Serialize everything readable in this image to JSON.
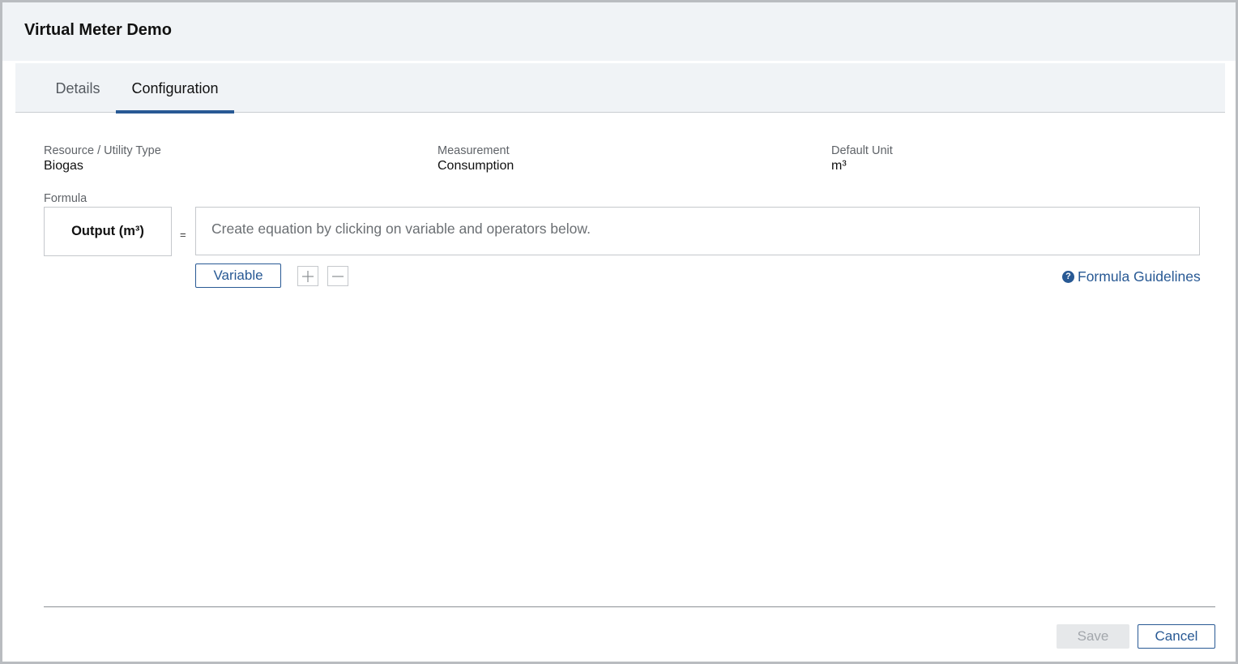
{
  "dialog": {
    "title": "Virtual Meter Demo"
  },
  "tabs": [
    {
      "label": "Details",
      "active": false
    },
    {
      "label": "Configuration",
      "active": true
    }
  ],
  "fields": {
    "resource_label": "Resource / Utility Type",
    "resource_value": "Biogas",
    "measurement_label": "Measurement",
    "measurement_value": "Consumption",
    "unit_label": "Default Unit",
    "unit_value": "m³"
  },
  "formula": {
    "label": "Formula",
    "output": "Output (m³)",
    "equals": "=",
    "placeholder": "Create equation by clicking on variable and operators below.",
    "variable_button": "Variable",
    "operators": [
      "+",
      "−"
    ],
    "guidelines_link": "Formula Guidelines",
    "help_icon": "question-circle-icon"
  },
  "footer": {
    "save_label": "Save",
    "save_disabled": true,
    "cancel_label": "Cancel"
  },
  "colors": {
    "accent": "#285994",
    "header_bg": "#f0f3f6",
    "disabled_bg": "#e6e8ea"
  }
}
